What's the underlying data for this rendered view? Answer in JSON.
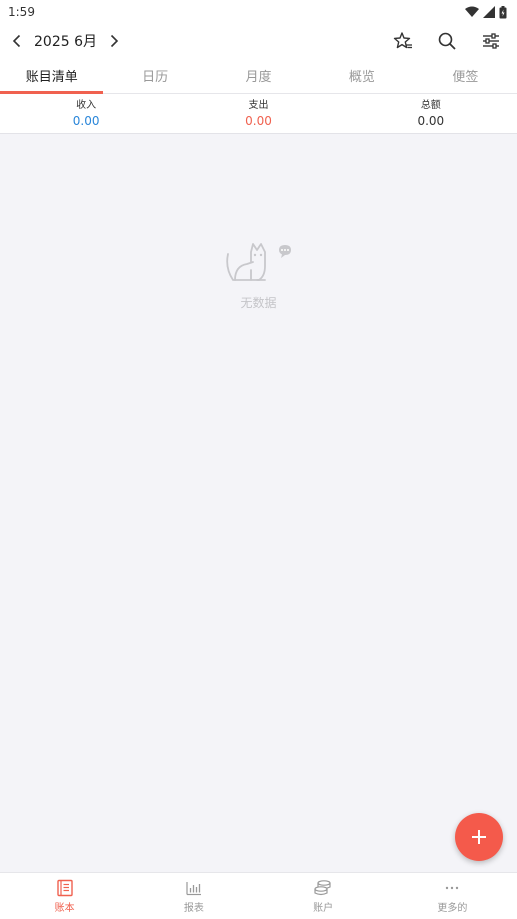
{
  "status": {
    "time": "1:59"
  },
  "header": {
    "month": "2025 6月"
  },
  "tabs": [
    {
      "label": "账目清单"
    },
    {
      "label": "日历"
    },
    {
      "label": "月度"
    },
    {
      "label": "概览"
    },
    {
      "label": "便签"
    }
  ],
  "summary": {
    "income": {
      "label": "收入",
      "value": "0.00"
    },
    "expense": {
      "label": "支出",
      "value": "0.00"
    },
    "total": {
      "label": "总额",
      "value": "0.00"
    }
  },
  "empty": {
    "text": "无数据"
  },
  "bottom_nav": [
    {
      "label": "账本",
      "icon": "ledger-icon"
    },
    {
      "label": "报表",
      "icon": "chart-icon"
    },
    {
      "label": "账户",
      "icon": "coins-icon"
    },
    {
      "label": "更多的",
      "icon": "more-icon"
    }
  ],
  "colors": {
    "accent": "#f0614f",
    "income": "#2a86d9",
    "expense": "#f0614f",
    "background": "#f4f4f8"
  }
}
